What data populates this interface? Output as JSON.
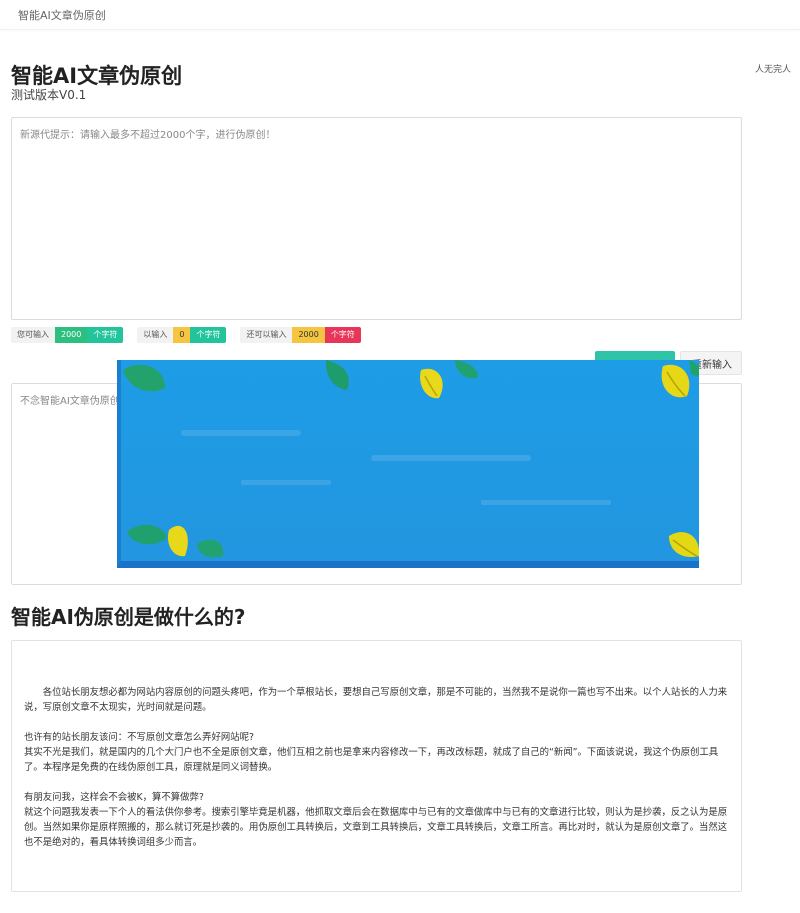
{
  "header": {
    "brand": "智能AI文章伪原创"
  },
  "user": {
    "name": "人无完人"
  },
  "page": {
    "title": "智能AI文章伪原创",
    "subtitle": "测试版本V0.1"
  },
  "input": {
    "placeholder": "新源代提示：请输入最多不超过2000个字，进行伪原创！",
    "value": ""
  },
  "counters": [
    {
      "label": "您可输入",
      "value": "2000",
      "unit": "个字符"
    },
    {
      "label": "以输入",
      "value": "0",
      "unit": "个字符"
    },
    {
      "label": "还可以输入",
      "value": "2000",
      "unit": "个字符"
    }
  ],
  "buttons": {
    "submit": "",
    "reset": "重新输入"
  },
  "output": {
    "placeholder": "不念智能AI文章伪原创",
    "value": ""
  },
  "ad_banner": {
    "color_top": "#1f9fe6",
    "color_bottom": "#1b73c9"
  },
  "section": {
    "title": "智能AI伪原创是做什么的?"
  },
  "article": {
    "p1": "各位站长朋友想必都为网站内容原创的问题头疼吧，作为一个草根站长，要想自己写原创文章，那是不可能的，当然我不是说你一篇也写不出来。以个人站长的人力来说，写原创文章不太现实，光时间就是问题。",
    "p2_q": "也许有的站长朋友该问：不写原创文章怎么弄好网站呢?",
    "p2": "其实不光是我们，就是国内的几个大门户也不全是原创文章，他们互相之前也是拿来内容修改一下，再改改标题，就成了自己的“新闻”。下面该说说，我这个伪原创工具了。本程序是免费的在线伪原创工具，原理就是同义词替换。",
    "p3_q": "有朋友问我，这样会不会被K，算不算做弊?",
    "p3": "就这个问题我发表一下个人的看法供你参考。搜索引擎毕竟是机器，他抓取文章后会在数据库中与已有的文章做库中与已有的文章进行比较，则认为是抄袭，反之认为是原创。当然如果你是原样照搬的，那么就订死是抄袭的。用伪原创工具转换后，文章到工具转换后，文章工具转换后，文章工所言。再比对时，就认为是原创文章了。当然这也不是绝对的，看具体转换词组多少而言。"
  }
}
